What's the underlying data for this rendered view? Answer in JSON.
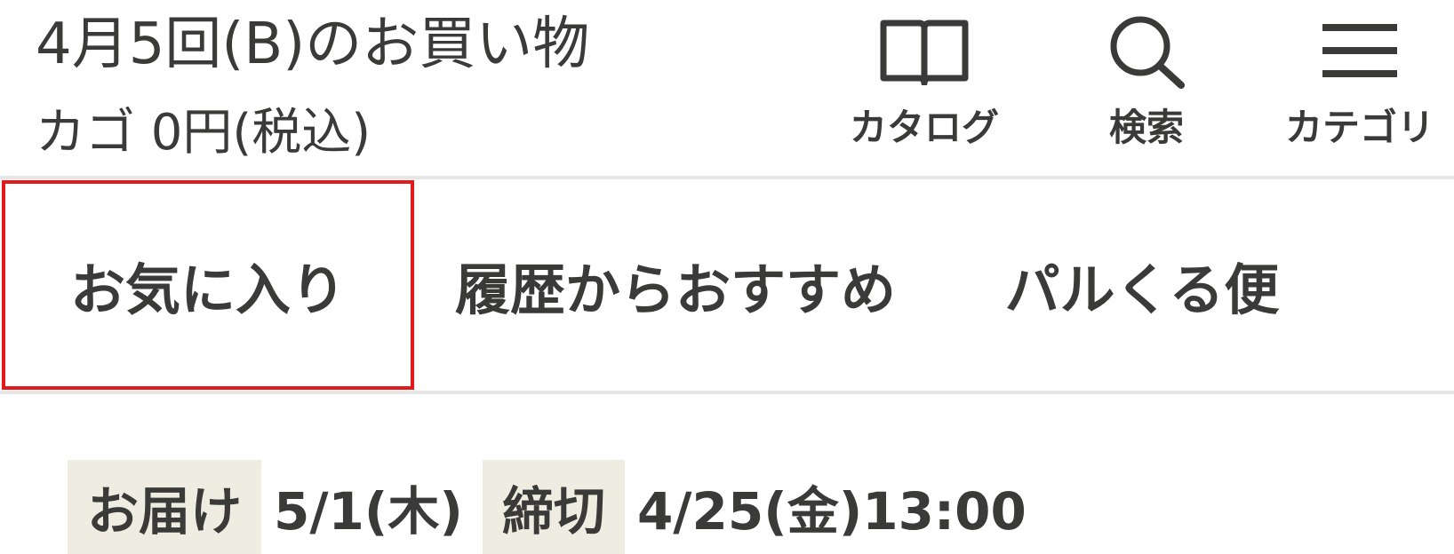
{
  "header": {
    "order_title": "4月5回(B)のお買い物",
    "cart_total": "カゴ 0円(税込)"
  },
  "nav": {
    "catalog": {
      "label": "カタログ",
      "icon": "book-icon"
    },
    "search": {
      "label": "検索",
      "icon": "search-icon"
    },
    "category": {
      "label": "カテゴリ",
      "icon": "hamburger-menu-icon"
    }
  },
  "tabs": [
    {
      "label": "お気に入り",
      "selected": true
    },
    {
      "label": "履歴からおすすめ",
      "selected": false
    },
    {
      "label": "パルくる便",
      "selected": false
    }
  ],
  "delivery": {
    "delivery_tag": "お届け",
    "delivery_date": "5/1(木)",
    "deadline_tag": "締切",
    "deadline_datetime": "4/25(金)13:00"
  },
  "colors": {
    "text": "#3a3a38",
    "tag_background": "#efede2",
    "selected_outline": "#e11a1a",
    "divider": "#e6e6e6"
  }
}
